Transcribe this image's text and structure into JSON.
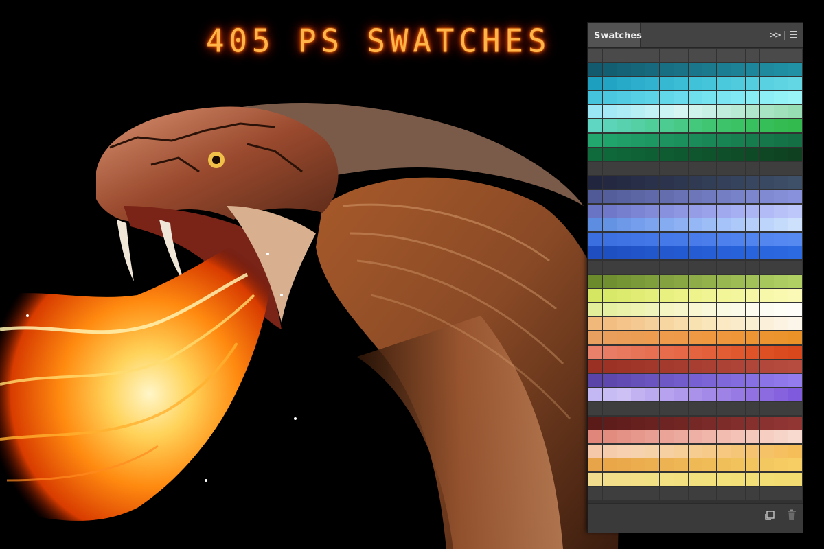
{
  "title": "405 PS SWATCHES",
  "panel": {
    "tab_label": "Swatches",
    "collapse_icon": "double-chevron-right-icon",
    "menu_icon": "hamburger-menu-icon",
    "footer_icons": [
      "new-swatch-icon",
      "trash-icon"
    ]
  },
  "swatches": {
    "columns": 15,
    "rows": [
      [
        "#4a4a4a",
        "#4a4a4a",
        "#4a4a4a",
        "#4a4a4a",
        "#4a4a4a",
        "#4a4a4a",
        "#4a4a4a",
        "#4a4a4a",
        "#4a4a4a",
        "#4a4a4a",
        "#4a4a4a",
        "#4a4a4a",
        "#4a4a4a",
        "#4a4a4a",
        "#4a4a4a"
      ],
      [
        "#135a6e",
        "#145e72",
        "#156276",
        "#16667a",
        "#176a7e",
        "#186e82",
        "#197286",
        "#1a768a",
        "#1b7a8e",
        "#1c7e92",
        "#1d8296",
        "#1e869a",
        "#1f8a9e",
        "#208ea2",
        "#2192a6"
      ],
      [
        "#1d9fc0",
        "#22a4c4",
        "#27a9c8",
        "#2caecc",
        "#31b3cf",
        "#36b8d2",
        "#3bbdd5",
        "#40c2d8",
        "#45c5da",
        "#4ac8dc",
        "#4fcbdd",
        "#54cede",
        "#59d1e0",
        "#5ed4e2",
        "#63d7e4"
      ],
      [
        "#45c3dc",
        "#4bc7df",
        "#51cbe2",
        "#57cfe5",
        "#5dd3e8",
        "#63d7ea",
        "#69dbec",
        "#6fdfee",
        "#75e3f0",
        "#7be6f2",
        "#81e9f3",
        "#87ecf4",
        "#8deff5",
        "#93f2f6",
        "#99f4f7"
      ],
      [
        "#9ae6f5",
        "#a4e9f5",
        "#aeecf5",
        "#b8eff5",
        "#c2f2f5",
        "#ccf4f5",
        "#d6f5f3",
        "#d0f3ec",
        "#c8f0e4",
        "#c0eddc",
        "#b8ead4",
        "#b0e7cc",
        "#a8e4c4",
        "#a0e1bc",
        "#98deb4"
      ],
      [
        "#5fd6c2",
        "#5cd4b8",
        "#58d2ae",
        "#54d0a4",
        "#50ce9a",
        "#4ccc90",
        "#48ca86",
        "#44c87c",
        "#40c672",
        "#3dc46a",
        "#3ac264",
        "#38c05e",
        "#36be58",
        "#34bc53",
        "#32ba4e"
      ],
      [
        "#22a86e",
        "#21a46b",
        "#20a068",
        "#1f9c65",
        "#1e9862",
        "#1d945f",
        "#1c905c",
        "#1b8c59",
        "#1a8856",
        "#198453",
        "#188050",
        "#177c4d",
        "#16784a",
        "#157447",
        "#147044"
      ],
      [
        "#0f6b3c",
        "#0f683a",
        "#0f6538",
        "#0f6236",
        "#0f5f34",
        "#0f5c32",
        "#0f5930",
        "#0f562e",
        "#0f532c",
        "#0f502a",
        "#0f4d28",
        "#0f4a26",
        "#0f4724",
        "#0f4422",
        "#0f4120"
      ],
      [
        "#3e3e3e",
        "#3e3e3e",
        "#3e3e3e",
        "#3e3e3e",
        "#3e3e3e",
        "#3e3e3e",
        "#3e3e3e",
        "#3e3e3e",
        "#3e3e3e",
        "#3e3e3e",
        "#3e3e3e",
        "#3e3e3e",
        "#3e3e3e",
        "#3e3e3e",
        "#3e3e3e"
      ],
      [
        "#22253e",
        "#242841",
        "#262b44",
        "#282e47",
        "#2a314a",
        "#2c344d",
        "#2e3750",
        "#303a53",
        "#323d56",
        "#344059",
        "#36435c",
        "#38465f",
        "#3a4962",
        "#3c4c65",
        "#3e4f68"
      ],
      [
        "#505a96",
        "#545e9b",
        "#5862a0",
        "#5c66a5",
        "#606aaa",
        "#646eaf",
        "#6872b4",
        "#6c76b9",
        "#707abe",
        "#747ec3",
        "#7882c8",
        "#7c86cd",
        "#808ad2",
        "#848ed7",
        "#8892dc"
      ],
      [
        "#6a74c4",
        "#7079c9",
        "#767fce",
        "#7c85d3",
        "#828bd8",
        "#8891dd",
        "#8e97e2",
        "#949de6",
        "#9aa3ea",
        "#a0a9ee",
        "#a6aff2",
        "#acb5f4",
        "#b2bbf6",
        "#b8c1f8",
        "#bec7fa"
      ],
      [
        "#5d8de0",
        "#6593e4",
        "#6d99e8",
        "#759fec",
        "#7da5ef",
        "#85abf1",
        "#8db1f3",
        "#95b7f5",
        "#9dbdf7",
        "#a5c3f8",
        "#adc9f9",
        "#b5cffa",
        "#bdd5fb",
        "#c5dbfc",
        "#cde1fd"
      ],
      [
        "#3b6ede",
        "#3d70e0",
        "#3f72e2",
        "#4174e4",
        "#4376e6",
        "#4578e8",
        "#477ae9",
        "#497cea",
        "#4b7eeb",
        "#4d80ec",
        "#4f82ed",
        "#5184ee",
        "#5386ef",
        "#5588f0",
        "#578af1"
      ],
      [
        "#1e4ebf",
        "#1f50c2",
        "#2052c5",
        "#2154c8",
        "#2256cb",
        "#2358ce",
        "#245ad1",
        "#255cd4",
        "#265ed6",
        "#2760d8",
        "#2862da",
        "#2964dc",
        "#2a66de",
        "#2b68e0",
        "#2c6ae2"
      ],
      [
        "#3e3e3e",
        "#3e3e3e",
        "#3e3e3e",
        "#3e3e3e",
        "#3e3e3e",
        "#3e3e3e",
        "#3e3e3e",
        "#3e3e3e",
        "#3e3e3e",
        "#3e3e3e",
        "#3e3e3e",
        "#3e3e3e",
        "#3e3e3e",
        "#3e3e3e",
        "#3e3e3e"
      ],
      [
        "#6b8a2c",
        "#708f30",
        "#759434",
        "#7a9938",
        "#7f9e3c",
        "#84a340",
        "#89a844",
        "#8ead48",
        "#93b24c",
        "#98b750",
        "#9dbc54",
        "#a2c158",
        "#a7c65c",
        "#accb60",
        "#b1d064"
      ],
      [
        "#d4e662",
        "#d8e868",
        "#dcea6e",
        "#e0ec74",
        "#e4ee7a",
        "#e8f080",
        "#ecf286",
        "#eef38c",
        "#f0f492",
        "#f2f598",
        "#f4f69e",
        "#f6f7a4",
        "#f8f8aa",
        "#f9f9b0",
        "#fafab6"
      ],
      [
        "#e2ee9a",
        "#e6f0a2",
        "#eaf2aa",
        "#eef3b2",
        "#f1f4ba",
        "#f4f5c2",
        "#f6f6ca",
        "#f8f7d2",
        "#f9f8da",
        "#faf9e2",
        "#fbfae8",
        "#fcfbee",
        "#fdfcf2",
        "#fefdf6",
        "#fefdf9"
      ],
      [
        "#f0b87a",
        "#f2be82",
        "#f4c48a",
        "#f5ca92",
        "#f6d09a",
        "#f7d6a2",
        "#f8dcaa",
        "#f9e2b2",
        "#f9e6ba",
        "#fae9c2",
        "#faecca",
        "#fbefd2",
        "#fbf1da",
        "#fcf3e2",
        "#fcf5ea"
      ],
      [
        "#e8a060",
        "#ea9f5c",
        "#eb9e58",
        "#ec9d54",
        "#ed9c50",
        "#ee9b4c",
        "#ef9a48",
        "#ef9944",
        "#ef9840",
        "#ef973c",
        "#ee9638",
        "#ed9534",
        "#ec9430",
        "#eb932c",
        "#ea9228"
      ],
      [
        "#e8806a",
        "#e87c64",
        "#e8785e",
        "#e87458",
        "#e87052",
        "#e76c4c",
        "#e66846",
        "#e56440",
        "#e4603a",
        "#e25c34",
        "#e0582e",
        "#de5428",
        "#dc5024",
        "#da4c20",
        "#d8481c"
      ],
      [
        "#9a3024",
        "#9c3226",
        "#9e3428",
        "#a0362a",
        "#a2382c",
        "#a43a2e",
        "#a63c30",
        "#a83e32",
        "#aa4034",
        "#ac4236",
        "#ae4438",
        "#b0463a",
        "#b2483c",
        "#b44a3e",
        "#b64c40"
      ],
      [
        "#5a44a8",
        "#5e48ae",
        "#624cb4",
        "#6650ba",
        "#6a54c0",
        "#6e58c6",
        "#725ccc",
        "#7660d2",
        "#7a64d6",
        "#7e68da",
        "#826cde",
        "#8670e2",
        "#8a74e6",
        "#8e78ea",
        "#927cee"
      ],
      [
        "#c4b8f4",
        "#c8bcf4",
        "#ccc0f4",
        "#c2b2f2",
        "#bcaaf0",
        "#b6a2ee",
        "#b09aec",
        "#aa92ea",
        "#a48ae8",
        "#9e82e6",
        "#987ae4",
        "#9272e2",
        "#8c6ae0",
        "#8662de",
        "#805adc"
      ],
      [
        "#3e3e3e",
        "#3e3e3e",
        "#3e3e3e",
        "#3e3e3e",
        "#3e3e3e",
        "#3e3e3e",
        "#3e3e3e",
        "#3e3e3e",
        "#3e3e3e",
        "#3e3e3e",
        "#3e3e3e",
        "#3e3e3e",
        "#3e3e3e",
        "#3e3e3e",
        "#3e3e3e"
      ],
      [
        "#5a1a18",
        "#5e1c1a",
        "#621e1c",
        "#66201e",
        "#6a2220",
        "#6e2422",
        "#722624",
        "#762826",
        "#7a2a28",
        "#7e2c2a",
        "#822e2c",
        "#86302e",
        "#8a3230",
        "#8e3432",
        "#923634"
      ],
      [
        "#e0867a",
        "#e28c80",
        "#e49286",
        "#e6988c",
        "#e89e92",
        "#eaa498",
        "#ecaa9e",
        "#eeb0a4",
        "#f0b6aa",
        "#f2bcb0",
        "#f4c2b6",
        "#f5c8bc",
        "#f6cec2",
        "#f7d4c8",
        "#f8dace"
      ],
      [
        "#f4c8a8",
        "#f5ccac",
        "#f6d0b0",
        "#f6d2ae",
        "#f6d2a8",
        "#f6d0a0",
        "#f6ce98",
        "#f6cc90",
        "#f6ca88",
        "#f6c880",
        "#f6c678",
        "#f6c470",
        "#f6c268",
        "#f6c060",
        "#f6be58"
      ],
      [
        "#e8a448",
        "#e9a74a",
        "#eaaa4c",
        "#ebad4e",
        "#ecb050",
        "#edb352",
        "#eeb654",
        "#efb956",
        "#f0bc58",
        "#f1bf5a",
        "#f2c25c",
        "#f3c55e",
        "#f4c860",
        "#f5cb62",
        "#f6ce64"
      ],
      [
        "#f0dc8c",
        "#f1dd8a",
        "#f2de88",
        "#f2df86",
        "#f2e084",
        "#f2e082",
        "#f2e080",
        "#f2e07e",
        "#f2e07c",
        "#f2e07a",
        "#f2df78",
        "#f2de76",
        "#f2dd74",
        "#f2dc72",
        "#f2db70"
      ],
      [
        "#3e3e3e",
        "#3e3e3e",
        "#3e3e3e",
        "#3e3e3e",
        "#3e3e3e",
        "#3e3e3e",
        "#3e3e3e",
        "#3e3e3e",
        "#3e3e3e",
        "#3e3e3e",
        "#3e3e3e",
        "#3e3e3e",
        "#3e3e3e",
        "#3e3e3e",
        "#3e3e3e"
      ]
    ]
  }
}
